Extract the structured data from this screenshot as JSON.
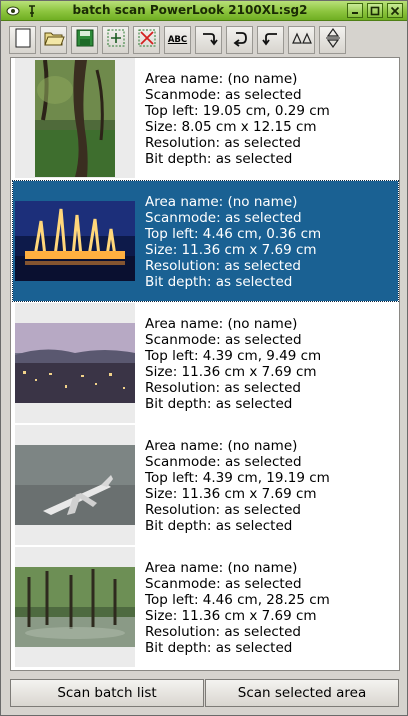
{
  "window": {
    "title": "batch scan PowerLook 2100XL:sg2"
  },
  "toolbar": {
    "buttons": [
      {
        "icon": "new-file-icon",
        "label": ""
      },
      {
        "icon": "open-folder-icon",
        "label": ""
      },
      {
        "icon": "save-icon",
        "label": ""
      },
      {
        "icon": "add-area-icon",
        "label": ""
      },
      {
        "icon": "delete-area-icon",
        "label": ""
      },
      {
        "icon": "ocr-icon",
        "label": "ABC"
      },
      {
        "icon": "rotate-right-icon",
        "label": ""
      },
      {
        "icon": "rotate-cw-icon",
        "label": ""
      },
      {
        "icon": "rotate-left-icon",
        "label": ""
      },
      {
        "icon": "mirror-icon",
        "label": ""
      },
      {
        "icon": "flip-icon",
        "label": ""
      }
    ]
  },
  "scan_list": {
    "selected_index": 1,
    "items": [
      {
        "area_name": "Area name: (no name)",
        "scanmode": "Scanmode: as selected",
        "top_left": "Top left: 19.05 cm, 0.29 cm",
        "size": "Size: 8.05 cm x 12.15 cm",
        "resolution": "Resolution: as selected",
        "bit_depth": "Bit depth: as selected",
        "thumbnail": "forest-tree-photo"
      },
      {
        "area_name": "Area name: (no name)",
        "scanmode": "Scanmode: as selected",
        "top_left": "Top left: 4.46 cm, 0.36 cm",
        "size": "Size: 11.36 cm x 7.69 cm",
        "resolution": "Resolution: as selected",
        "bit_depth": "Bit depth: as selected",
        "thumbnail": "fountain-night-photo"
      },
      {
        "area_name": "Area name: (no name)",
        "scanmode": "Scanmode: as selected",
        "top_left": "Top left: 4.39 cm, 9.49 cm",
        "size": "Size: 11.36 cm x 7.69 cm",
        "resolution": "Resolution: as selected",
        "bit_depth": "Bit depth: as selected",
        "thumbnail": "city-dusk-photo"
      },
      {
        "area_name": "Area name: (no name)",
        "scanmode": "Scanmode: as selected",
        "top_left": "Top left: 4.39 cm, 19.19 cm",
        "size": "Size: 11.36 cm x 7.69 cm",
        "resolution": "Resolution: as selected",
        "bit_depth": "Bit depth: as selected",
        "thumbnail": "airplane-sky-photo"
      },
      {
        "area_name": "Area name: (no name)",
        "scanmode": "Scanmode: as selected",
        "top_left": "Top left: 4.46 cm, 28.25 cm",
        "size": "Size: 11.36 cm x 7.69 cm",
        "resolution": "Resolution: as selected",
        "bit_depth": "Bit depth: as selected",
        "thumbnail": "flooded-forest-photo"
      }
    ]
  },
  "buttons": {
    "scan_batch": "Scan batch list",
    "scan_selected": "Scan selected area"
  },
  "colors": {
    "titlebar": "#8cc43e",
    "selection": "#1a6193"
  }
}
